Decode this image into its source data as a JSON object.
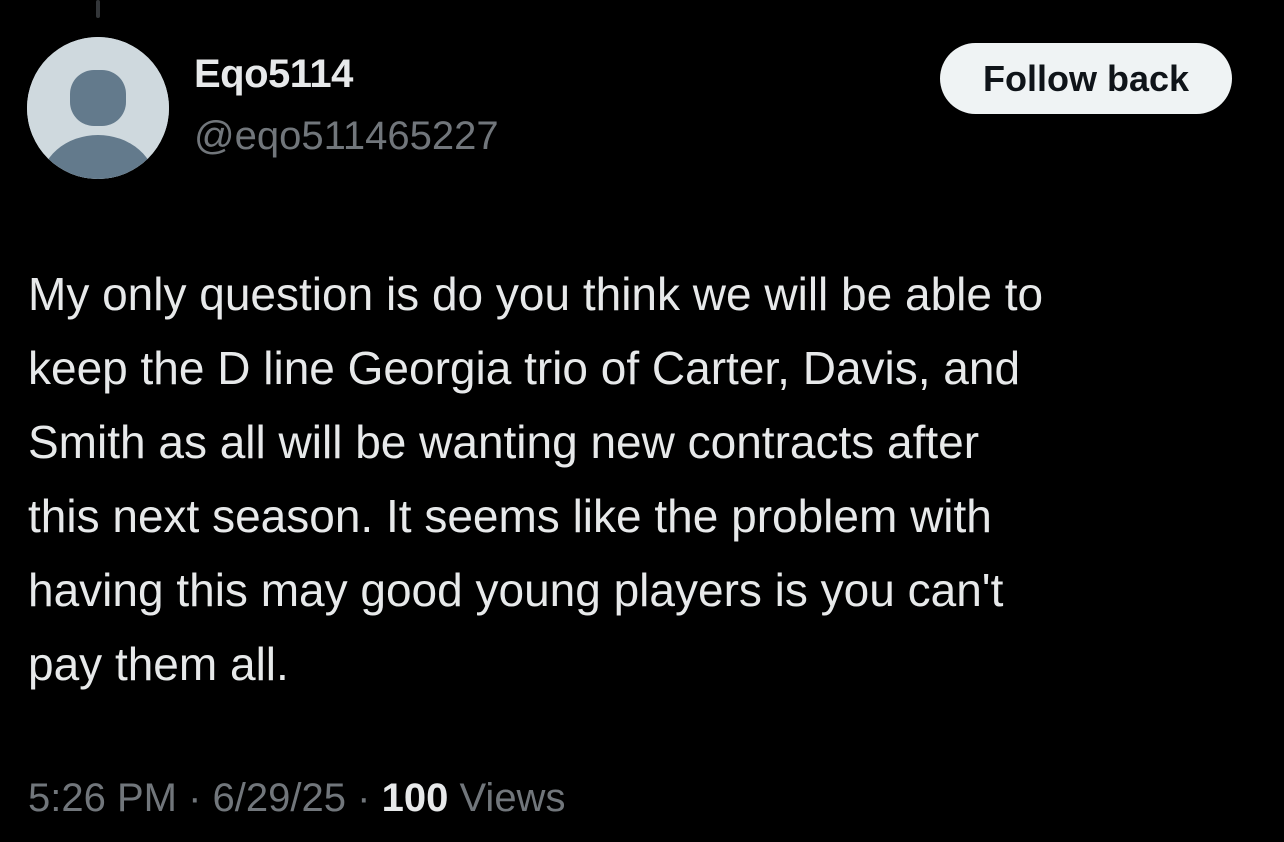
{
  "author": {
    "display_name": "Eqo5114",
    "handle": "@eqo511465227",
    "avatar_icon": "default-avatar-icon"
  },
  "follow_button": {
    "label": "Follow back"
  },
  "tweet": {
    "text_lines": [
      "My only question is do you think we will be able to",
      "keep the D line Georgia trio of Carter, Davis, and",
      "Smith as all will be wanting new contracts after",
      "this next season. It seems like the problem with",
      "having this may good young players is you can't",
      "pay them all."
    ],
    "time": "5:26 PM",
    "separator": "·",
    "date": "6/29/25",
    "views_count": "100",
    "views_label": "Views"
  },
  "colors": {
    "background": "#000000",
    "primary_text": "#e7e9ea",
    "secondary_text": "#71767b",
    "button_bg": "#eff3f4",
    "avatar_bg": "#cfd9de",
    "avatar_figure": "#637a8c"
  }
}
